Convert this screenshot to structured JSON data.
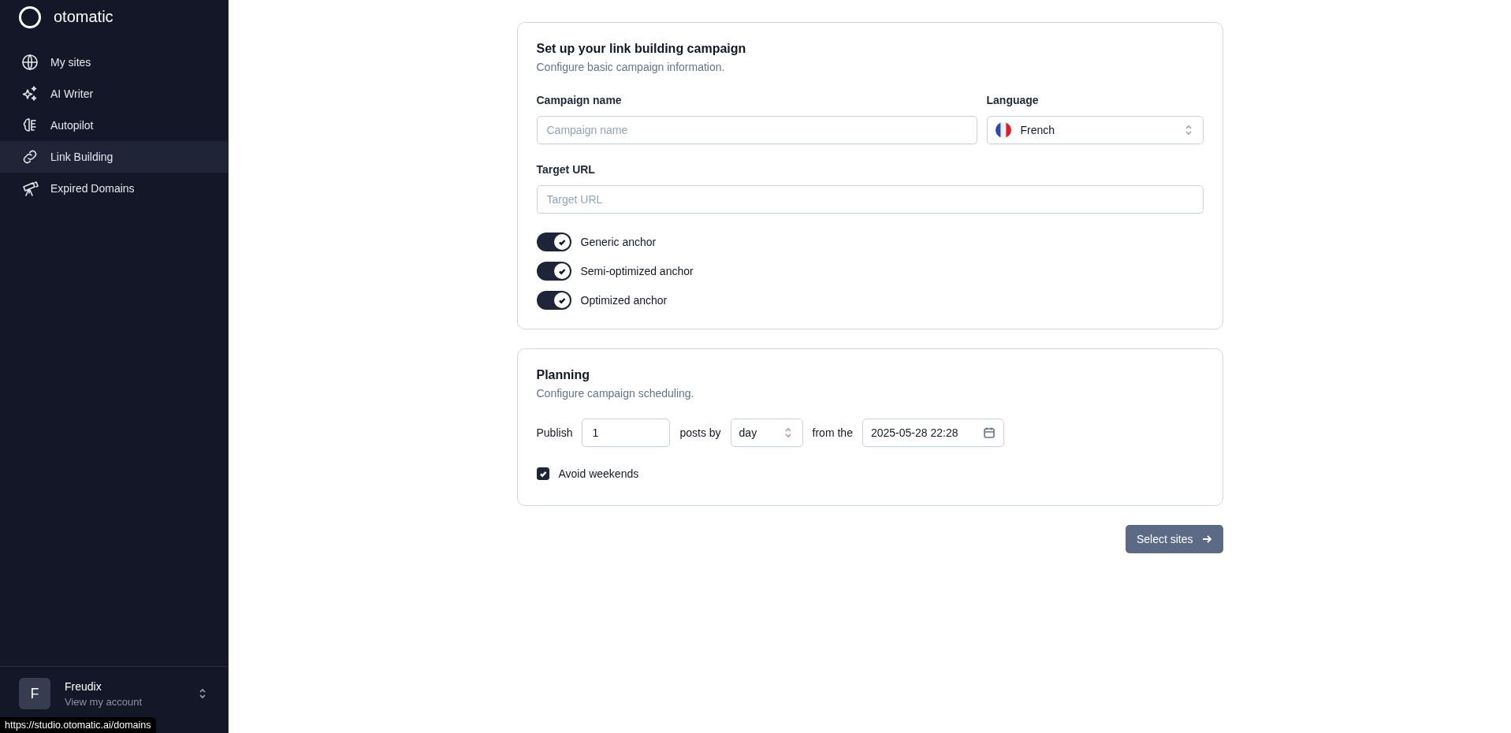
{
  "sidebar": {
    "brand": "otomatic",
    "items": [
      {
        "label": "My sites",
        "selected": false
      },
      {
        "label": "AI Writer",
        "selected": false
      },
      {
        "label": "Autopilot",
        "selected": false
      },
      {
        "label": "Link Building",
        "selected": true
      },
      {
        "label": "Expired Domains",
        "selected": false
      }
    ],
    "account": {
      "initial": "F",
      "name": "Freudix",
      "subtitle": "View my account"
    }
  },
  "campaign_card": {
    "title": "Set up your link building campaign",
    "subtitle": "Configure basic campaign information.",
    "campaign_name": {
      "label": "Campaign name",
      "placeholder": "Campaign name"
    },
    "language": {
      "label": "Language",
      "value": "French"
    },
    "target_url": {
      "label": "Target URL",
      "placeholder": "Target URL"
    },
    "toggles": [
      {
        "label": "Generic anchor",
        "on": true
      },
      {
        "label": "Semi-optimized anchor",
        "on": true
      },
      {
        "label": "Optimized anchor",
        "on": true
      }
    ]
  },
  "planning_card": {
    "title": "Planning",
    "subtitle": "Configure campaign scheduling.",
    "publish_label": "Publish",
    "count": "1",
    "posts_by_label": "posts by",
    "period": "day",
    "from_label": "from the",
    "start": "2025-05-28 22:28",
    "avoid_weekends": {
      "label": "Avoid weekends",
      "checked": true
    }
  },
  "next_button": "Select sites",
  "status_url": "https://studio.otomatic.ai/domains"
}
